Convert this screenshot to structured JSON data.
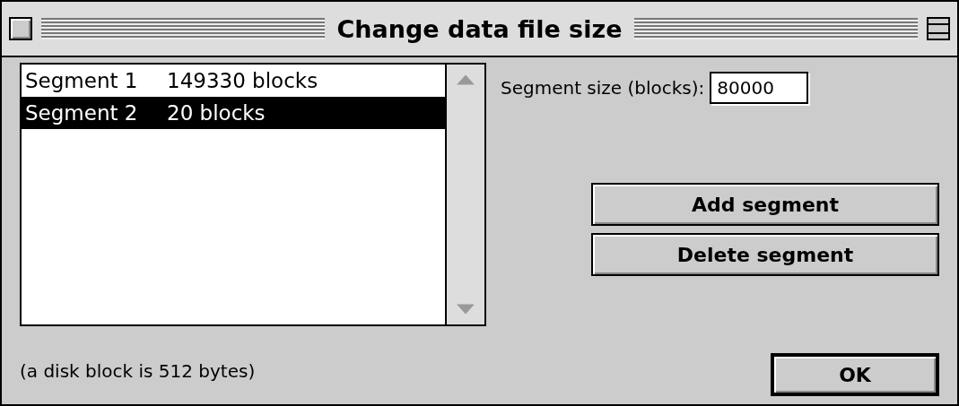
{
  "window": {
    "title": "Change data file size"
  },
  "segments": [
    {
      "name": "Segment 1",
      "size": "149330 blocks",
      "selected": false
    },
    {
      "name": "Segment 2",
      "size": "20 blocks",
      "selected": true
    }
  ],
  "segment_size": {
    "label": "Segment size (blocks):",
    "value": "80000"
  },
  "buttons": [
    {
      "label": "Add segment",
      "default": false
    },
    {
      "label": "Delete segment",
      "default": false
    },
    {
      "label": "OK",
      "default": true
    }
  ],
  "note": "(a disk block is 512 bytes)"
}
